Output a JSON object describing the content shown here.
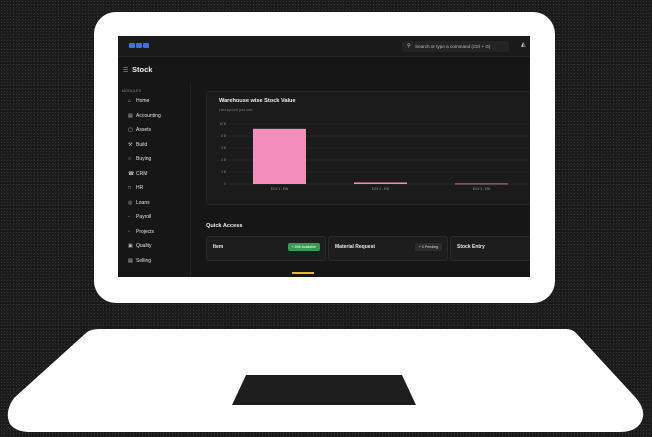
{
  "app": {
    "search_placeholder": "Search or type a command (Ctrl + G)",
    "page_title": "Stock",
    "accent_color": "#3f6fe0"
  },
  "sidebar": {
    "section_label": "MODULES",
    "items": [
      {
        "label": "Home",
        "icon": "home-icon"
      },
      {
        "label": "Accounting",
        "icon": "accounting-icon"
      },
      {
        "label": "Assets",
        "icon": "assets-icon"
      },
      {
        "label": "Build",
        "icon": "build-icon"
      },
      {
        "label": "Buying",
        "icon": "buying-icon"
      },
      {
        "label": "CRM",
        "icon": "crm-icon"
      },
      {
        "label": "HR",
        "icon": "hr-icon"
      },
      {
        "label": "Loans",
        "icon": "loans-icon"
      },
      {
        "label": "Payroll",
        "icon": "payroll-icon"
      },
      {
        "label": "Projects",
        "icon": "projects-icon"
      },
      {
        "label": "Quality",
        "icon": "quality-icon"
      },
      {
        "label": "Selling",
        "icon": "selling-icon"
      }
    ]
  },
  "stock_card": {
    "title": "Warehouse wise Stock Value",
    "subtitle": "Last synced just now"
  },
  "chart_data": {
    "type": "bar",
    "categories": [
      "EGY 1 - EW",
      "EGY 2 - EW",
      "EGY 3 - EW"
    ],
    "values": [
      9.2,
      0.25,
      0.08
    ],
    "ylim": [
      0,
      10
    ],
    "yticks": [
      "10 B",
      "8 B",
      "6 B",
      "4 B",
      "2 B",
      "0"
    ],
    "bar_color": "#f48fbb",
    "grid": true
  },
  "quick_access": {
    "title": "Quick Access",
    "cards": [
      {
        "title": "Item",
        "badge": "+ 896 Available",
        "badge_style": "green"
      },
      {
        "title": "Material Request",
        "badge": "+ 0 Pending",
        "badge_style": "dark"
      },
      {
        "title": "Stock Entry",
        "badge": "",
        "badge_style": "none"
      }
    ]
  }
}
